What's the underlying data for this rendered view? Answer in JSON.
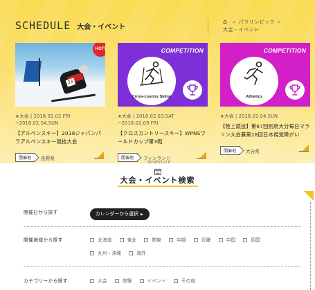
{
  "header": {
    "title_en": "SCHEDULE",
    "title_jp": "大会・イベント",
    "breadcrumb": [
      "パラリンピック",
      "大会・イベント"
    ]
  },
  "cards": [
    {
      "badge": "HOT!",
      "date_line1": "★大会 | 2018.02.02.FRI",
      "date_line2": "~2018.02.04.SUN",
      "title": "【アルペンスキー】2018ジャパンパラアルペンスキー競技大会",
      "place_tag": "開催地",
      "place": "長野県"
    },
    {
      "image_label": "COMPETITION",
      "sport": "Cross-country Skiing",
      "date_line1": "★大会 | 2018.02.03.SAT",
      "date_line2": "~2018.02.09.FRI",
      "title": "【クロスカントリースキー】WPNSワールドカップ第3戦",
      "place_tag": "開催地",
      "place": "フィンランド"
    },
    {
      "image_label": "COMPETITION",
      "sport": "Athletics",
      "date_line1": "★大会 | 2018.02.04.SUN",
      "date_line2": "",
      "title": "【陸上競技】第67回別府大分毎日マラソン大会兼第18回日本視覚障がい",
      "place_tag": "開催地",
      "place": "大分県"
    }
  ],
  "search": {
    "badge_text": "SCHEDULE",
    "title": "大会・イベント検索",
    "by_date_label": "開催日から探す",
    "calendar_button": "カレンダーから選択",
    "by_region_label": "開催地域から探す",
    "regions_row1": [
      "北海道",
      "東北",
      "関東",
      "中部",
      "近畿",
      "中国",
      "四国"
    ],
    "regions_row2": [
      "九州・沖縄",
      "海外"
    ],
    "by_category_label": "カテゴリーから探す",
    "categories": [
      "大会",
      "体験",
      "イベント",
      "その他"
    ]
  },
  "colors": {
    "header_yellow": "#f9db52",
    "competition_purple": "#7f2fd8",
    "competition_magenta": "#d21fc8",
    "hot_red": "#e0282c",
    "star_gold": "#f0b400"
  }
}
